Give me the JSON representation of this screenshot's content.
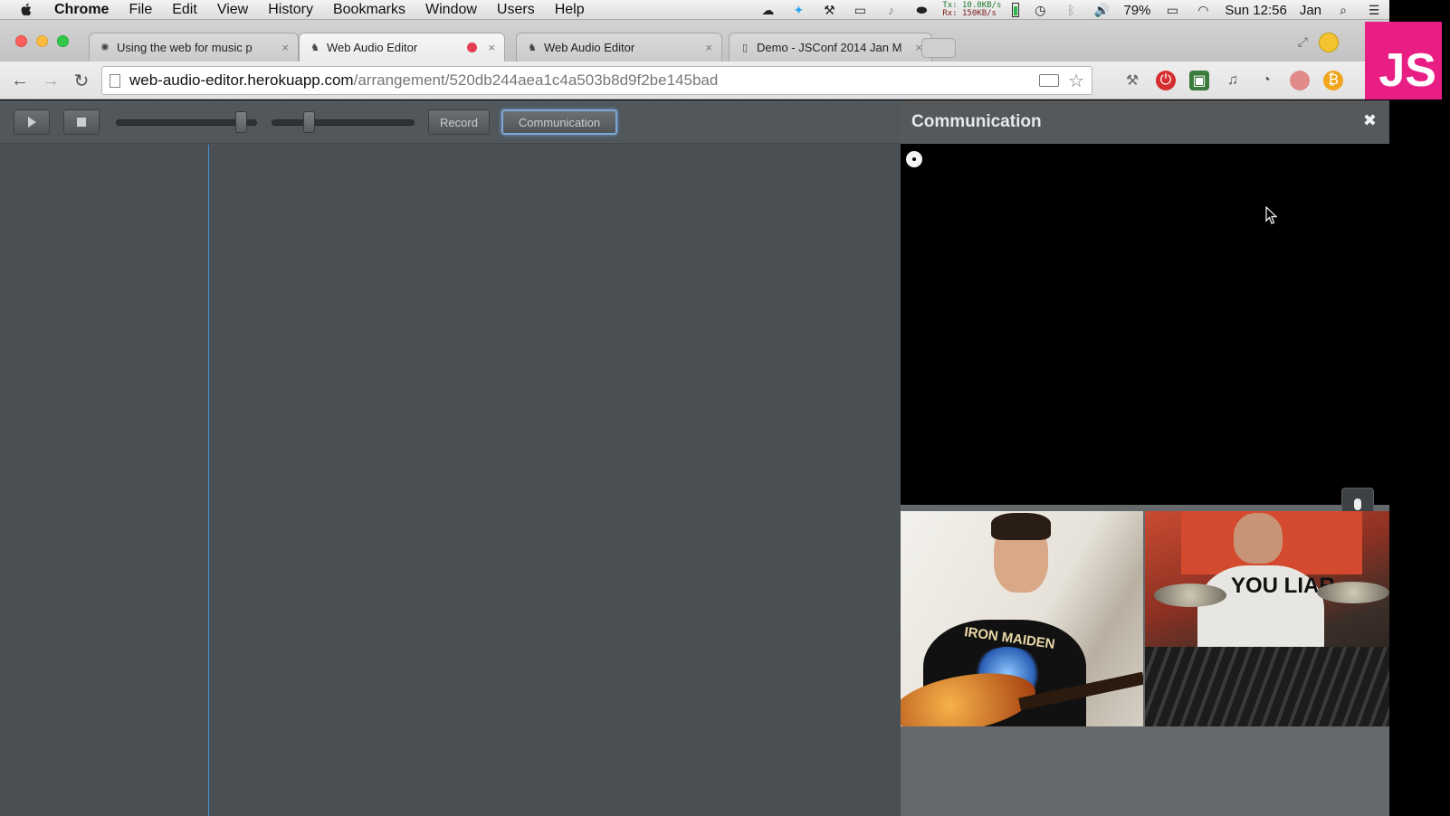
{
  "menubar": {
    "app_name": "Chrome",
    "items": [
      "File",
      "Edit",
      "View",
      "History",
      "Bookmarks",
      "Window",
      "Users",
      "Help"
    ],
    "net_tx": "Tx: 10.0KB/s",
    "net_rx": "Rx: 150KB/s",
    "battery_percent": "79%",
    "clock": "Sun 12:56",
    "user": "Jan"
  },
  "tabs": [
    {
      "title": "Using the web for music p",
      "favicon": "loading-icon",
      "active": false
    },
    {
      "title": "Web Audio Editor",
      "favicon": "app-icon",
      "active": true,
      "recording": true
    },
    {
      "title": "Web Audio Editor",
      "favicon": "app-icon",
      "active": false
    },
    {
      "title": "Demo - JSConf 2014 Jan M",
      "favicon": "document-icon",
      "active": false
    }
  ],
  "address": {
    "host": "web-audio-editor.herokuapp.com",
    "path": "/arrangement/520db244aea1c4a503b8d9f2be145bad"
  },
  "editor": {
    "record_label": "Record",
    "communication_label": "Communication",
    "master_volume": 0.92,
    "zoom_level": 0.24
  },
  "communication_panel": {
    "title": "Communication",
    "close_glyph": "✖",
    "left_cam_text": "IRON MAIDEN",
    "right_cam_text": "YOU LIAR"
  },
  "badge": {
    "text": "JS",
    "color": "#e91e84"
  },
  "colors": {
    "accent_blue": "#7fa7d4",
    "playhead": "#3f8fd8",
    "recording_red": "#e63d55"
  }
}
